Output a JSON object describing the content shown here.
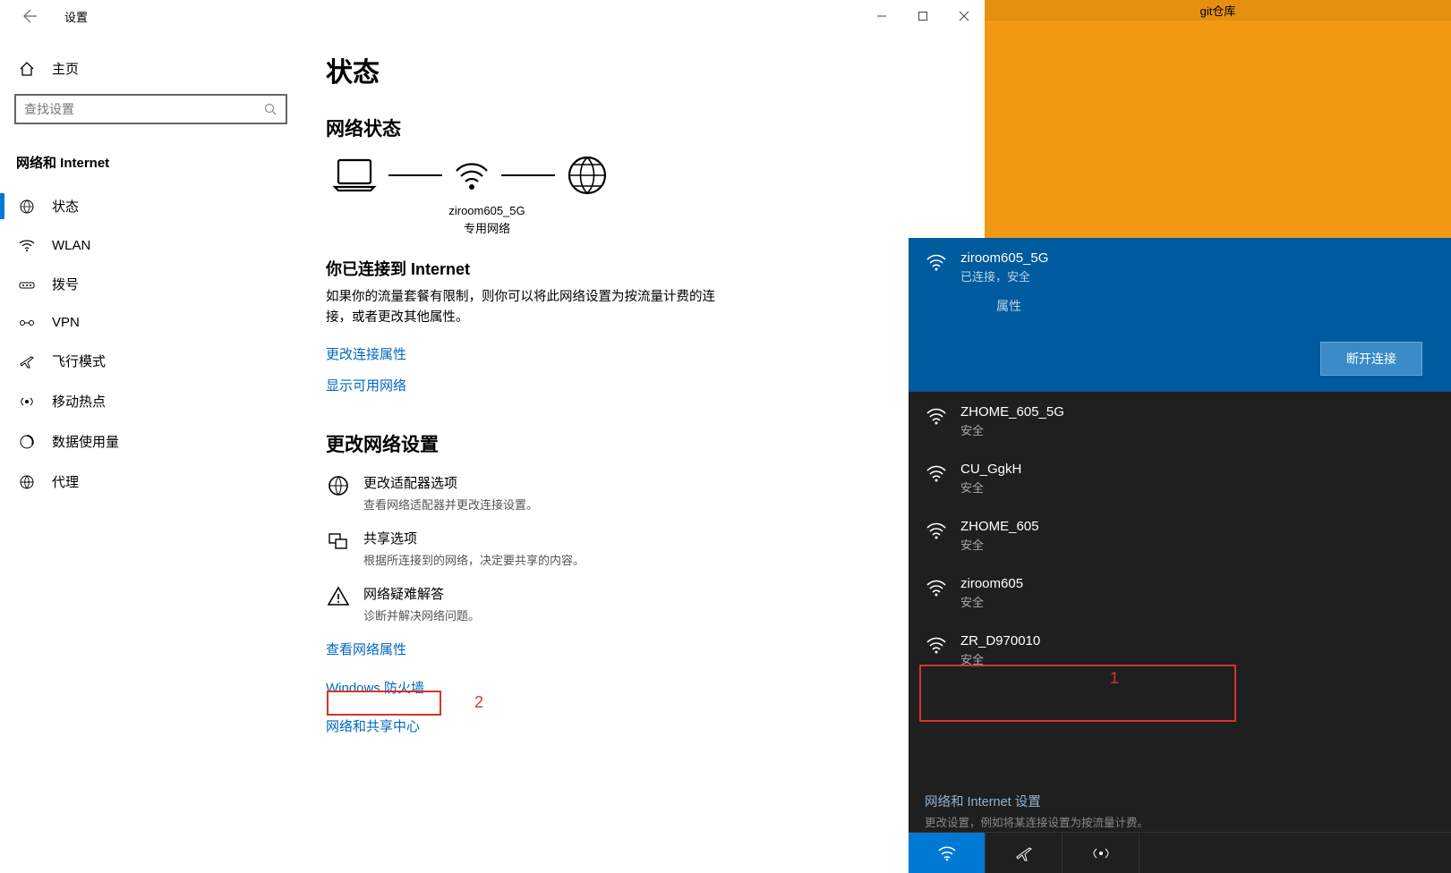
{
  "settings": {
    "title": "设置",
    "home": "主页",
    "search_placeholder": "查找设置",
    "category": "网络和 Internet",
    "nav": [
      {
        "label": "状态"
      },
      {
        "label": "WLAN"
      },
      {
        "label": "拨号"
      },
      {
        "label": "VPN"
      },
      {
        "label": "飞行模式"
      },
      {
        "label": "移动热点"
      },
      {
        "label": "数据使用量"
      },
      {
        "label": "代理"
      }
    ]
  },
  "status": {
    "heading": "状态",
    "network_status": "网络状态",
    "diagram": {
      "ssid": "ziroom605_5G",
      "nettype": "专用网络"
    },
    "connected_title": "你已连接到 Internet",
    "connected_desc": "如果你的流量套餐有限制，则你可以将此网络设置为按流量计费的连接，或者更改其他属性。",
    "change_conn_props": "更改连接属性",
    "show_available": "显示可用网络",
    "change_settings_h": "更改网络设置",
    "opts": [
      {
        "title": "更改适配器选项",
        "desc": "查看网络适配器并更改连接设置。"
      },
      {
        "title": "共享选项",
        "desc": "根据所连接到的网络，决定要共享的内容。"
      },
      {
        "title": "网络疑难解答",
        "desc": "诊断并解决网络问题。"
      }
    ],
    "view_props": "查看网络属性",
    "firewall": "Windows 防火墙",
    "sharing_center": "网络和共享中心"
  },
  "bgwin": {
    "title": "git仓库"
  },
  "flyout": {
    "connected": {
      "name": "ziroom605_5G",
      "status": "已连接，安全",
      "props": "属性",
      "disconnect": "断开连接"
    },
    "networks": [
      {
        "name": "ZHOME_605_5G",
        "sub": "安全"
      },
      {
        "name": "CU_GgkH",
        "sub": "安全"
      },
      {
        "name": "ZHOME_605",
        "sub": "安全"
      },
      {
        "name": "ziroom605",
        "sub": "安全"
      },
      {
        "name": "ZR_D970010",
        "sub": "安全"
      }
    ],
    "footer_title": "网络和 Internet 设置",
    "footer_desc": "更改设置，例如将某连接设置为按流量计费。"
  },
  "annotations": {
    "a1": "1",
    "a2": "2"
  }
}
